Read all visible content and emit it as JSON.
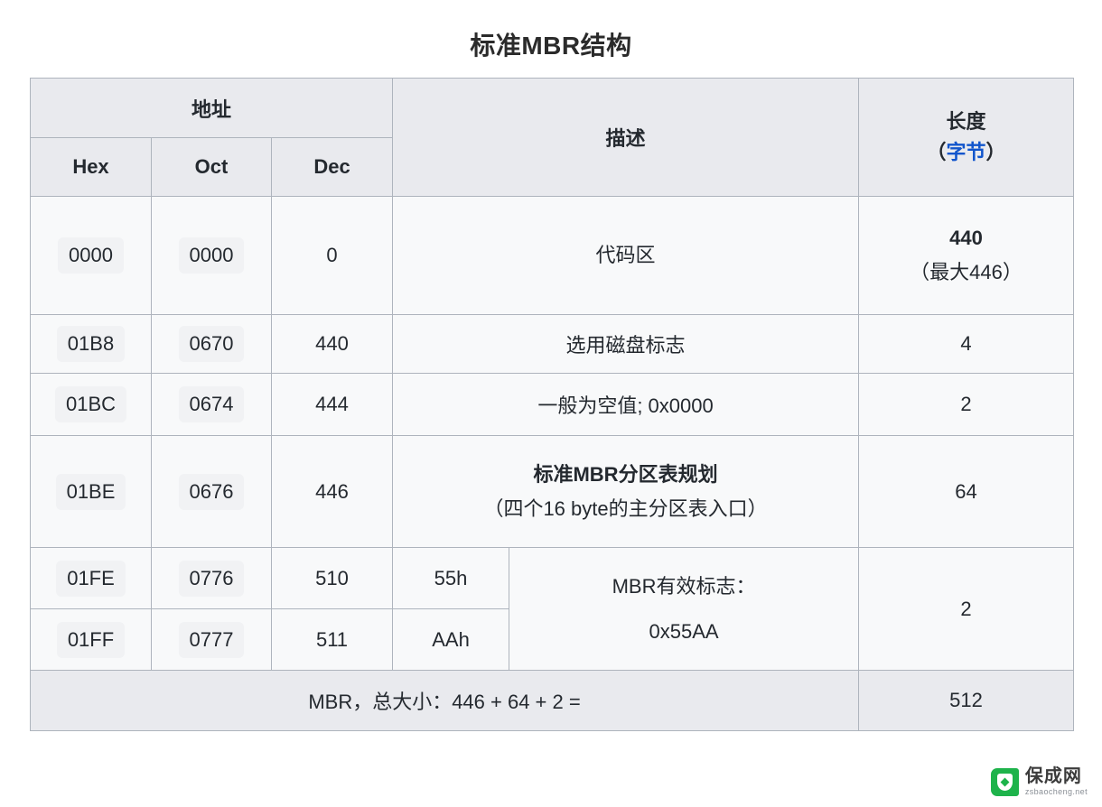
{
  "page": {
    "title": "标准MBR结构"
  },
  "table": {
    "headers": {
      "address_group": "地址",
      "hex": "Hex",
      "oct": "Oct",
      "dec": "Dec",
      "description": "描述",
      "length_line1": "长度",
      "length_paren_open": "（",
      "length_unit": "字节",
      "length_paren_close": "）"
    },
    "rows": [
      {
        "hex": "0000",
        "oct": "0000",
        "dec": "0",
        "description_line1": "代码区",
        "description_line2": "",
        "length_line1": "440",
        "length_line2": "（最大446）",
        "length_bold": true
      },
      {
        "hex": "01B8",
        "oct": "0670",
        "dec": "440",
        "description_line1": "选用磁盘标志",
        "description_line2": "",
        "length_line1": "4",
        "length_line2": "",
        "length_bold": false
      },
      {
        "hex": "01BC",
        "oct": "0674",
        "dec": "444",
        "description_line1": "一般为空值; 0x0000",
        "description_line2": "",
        "length_line1": "2",
        "length_line2": "",
        "length_bold": false
      },
      {
        "hex": "01BE",
        "oct": "0676",
        "dec": "446",
        "description_line1": "标准MBR分区表规划",
        "description_line2": "（四个16 byte的主分区表入口）",
        "length_line1": "64",
        "length_line2": "",
        "length_bold": true
      }
    ],
    "signature_rows": [
      {
        "hex": "01FE",
        "oct": "0776",
        "dec": "510",
        "signature": "55h"
      },
      {
        "hex": "01FF",
        "oct": "0777",
        "dec": "511",
        "signature": "AAh"
      }
    ],
    "signature_description_line1": "MBR有效标志：",
    "signature_description_line2": "0x55AA",
    "signature_length": "2",
    "footer": {
      "label": "MBR，总大小：446 + 64 + 2 =",
      "value": "512"
    }
  },
  "watermark": {
    "name": "保成网",
    "url": "zsbaocheng.net"
  },
  "colors": {
    "header_bg": "#e9eaee",
    "body_bg": "#f8f9fa",
    "border": "#aeb4bd",
    "link_blue": "#1155cc",
    "text": "#24292f",
    "watermark_green": "#1eb34b"
  }
}
